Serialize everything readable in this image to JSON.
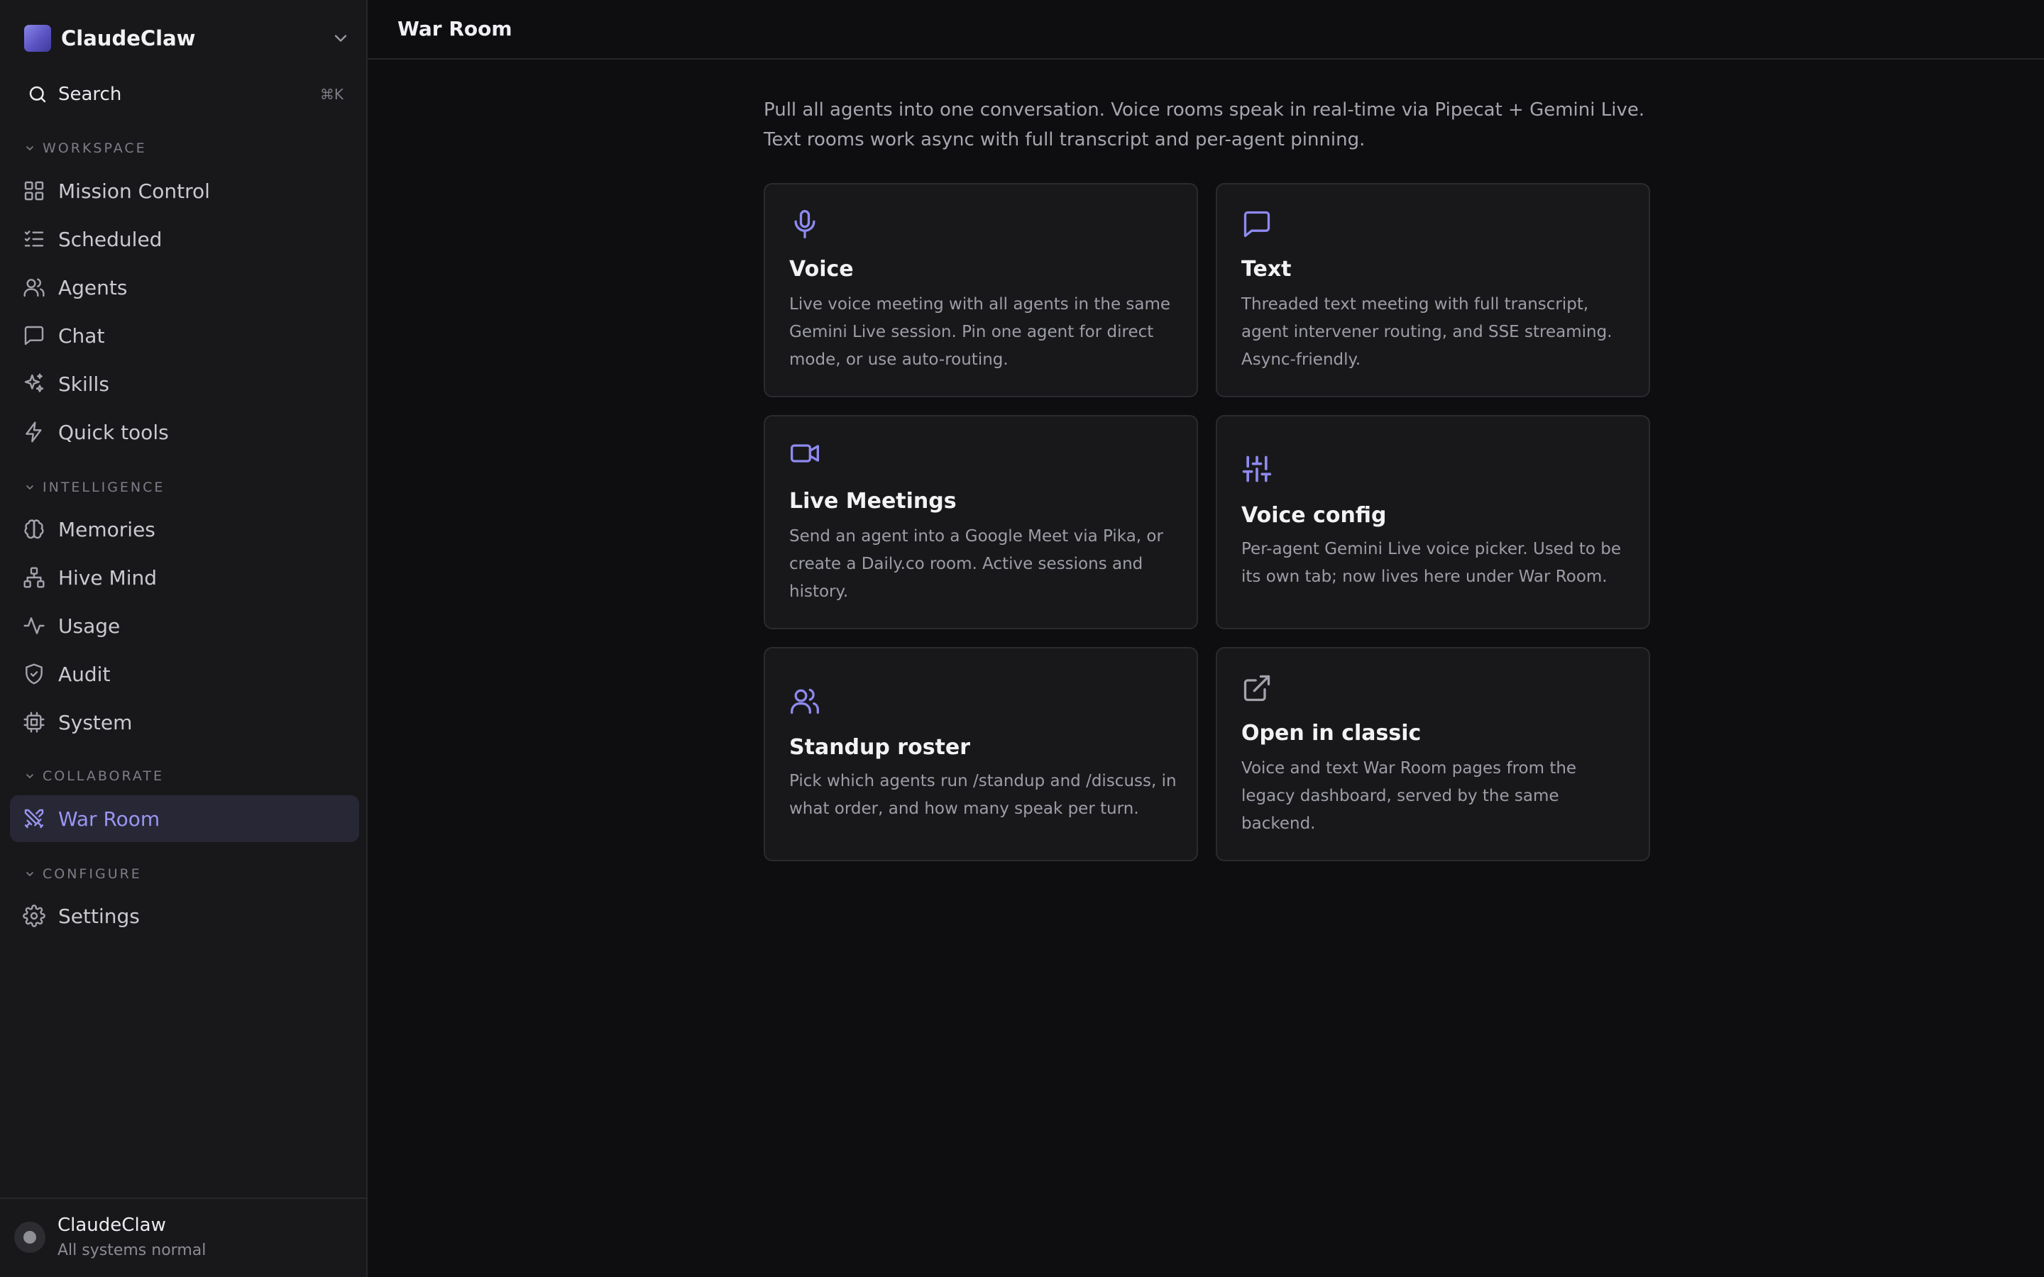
{
  "sidebar": {
    "brand": {
      "name": "ClaudeClaw"
    },
    "search": {
      "label": "Search",
      "shortcut": "⌘K"
    },
    "sections": [
      {
        "title": "WORKSPACE",
        "items": [
          {
            "label": "Mission Control",
            "icon": "grid-icon"
          },
          {
            "label": "Scheduled",
            "icon": "list-checks-icon"
          },
          {
            "label": "Agents",
            "icon": "users-icon"
          },
          {
            "label": "Chat",
            "icon": "message-square-icon"
          },
          {
            "label": "Skills",
            "icon": "sparkles-icon"
          },
          {
            "label": "Quick tools",
            "icon": "zap-icon"
          }
        ]
      },
      {
        "title": "INTELLIGENCE",
        "items": [
          {
            "label": "Memories",
            "icon": "brain-icon"
          },
          {
            "label": "Hive Mind",
            "icon": "network-icon"
          },
          {
            "label": "Usage",
            "icon": "activity-icon"
          },
          {
            "label": "Audit",
            "icon": "shield-check-icon"
          },
          {
            "label": "System",
            "icon": "cpu-icon"
          }
        ]
      },
      {
        "title": "COLLABORATE",
        "items": [
          {
            "label": "War Room",
            "icon": "swords-icon",
            "active": true
          }
        ]
      },
      {
        "title": "CONFIGURE",
        "items": [
          {
            "label": "Settings",
            "icon": "gear-icon"
          }
        ]
      }
    ],
    "footer": {
      "name": "ClaudeClaw",
      "status": "All systems normal"
    }
  },
  "header": {
    "title": "War Room"
  },
  "main": {
    "intro": "Pull all agents into one conversation. Voice rooms speak in real-time via Pipecat + Gemini Live. Text rooms work async with full transcript and per-agent pinning.",
    "cards": [
      {
        "title": "Voice",
        "icon": "microphone-icon",
        "description": "Live voice meeting with all agents in the same Gemini Live session. Pin one agent for direct mode, or use auto-routing."
      },
      {
        "title": "Text",
        "icon": "message-square-icon",
        "description": "Threaded text meeting with full transcript, agent intervener routing, and SSE streaming. Async-friendly."
      },
      {
        "title": "Live Meetings",
        "icon": "video-camera-icon",
        "description": "Send an agent into a Google Meet via Pika, or create a Daily.co room. Active sessions and history."
      },
      {
        "title": "Voice config",
        "icon": "sliders-icon",
        "description": "Per-agent Gemini Live voice picker. Used to be its own tab; now lives here under War Room."
      },
      {
        "title": "Standup roster",
        "icon": "users-icon",
        "description": "Pick which agents run /standup and /discuss, in what order, and how many speak per turn."
      },
      {
        "title": "Open in classic",
        "icon": "external-link-icon",
        "description": "Voice and text War Room pages from the legacy dashboard, served by the same backend."
      }
    ]
  },
  "colors": {
    "background": "#0e0e10",
    "sidebar": "#18181b",
    "accent": "#8f8af0",
    "active_item_bg": "#272736"
  }
}
